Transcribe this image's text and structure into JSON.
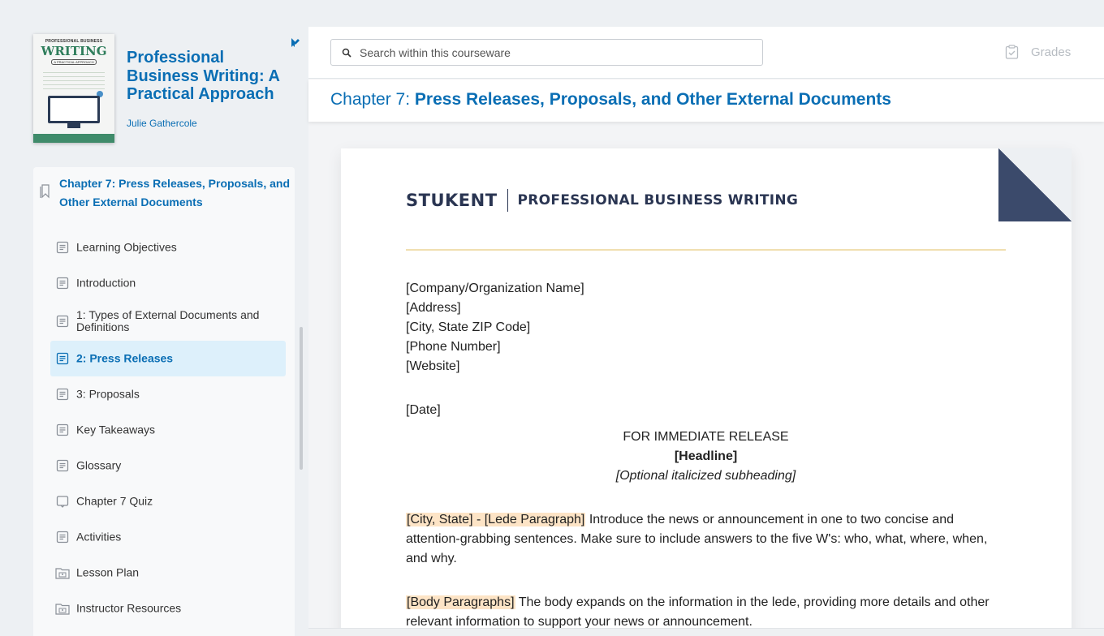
{
  "book": {
    "cover_small_text": "PROFESSIONAL BUSINESS",
    "cover_big_text": "WRITING",
    "cover_subtitle": "A PRACTICAL APPROACH",
    "title": "Professional Business Writing: A Practical Approach",
    "author": "Julie Gathercole"
  },
  "toc": {
    "chapter_label": "Chapter 7: Press Releases, Proposals, and Other External Documents",
    "items": [
      {
        "label": "Learning Objectives",
        "icon": "page-icon"
      },
      {
        "label": "Introduction",
        "icon": "page-icon"
      },
      {
        "label": "1: Types of External Documents and Definitions",
        "icon": "page-icon"
      },
      {
        "label": "2: Press Releases",
        "icon": "page-icon",
        "active": true
      },
      {
        "label": "3: Proposals",
        "icon": "page-icon"
      },
      {
        "label": "Key Takeaways",
        "icon": "page-icon"
      },
      {
        "label": "Glossary",
        "icon": "page-icon"
      },
      {
        "label": "Chapter 7 Quiz",
        "icon": "quiz-icon"
      },
      {
        "label": "Activities",
        "icon": "page-icon"
      },
      {
        "label": "Lesson Plan",
        "icon": "folder-icon"
      },
      {
        "label": "Instructor Resources",
        "icon": "folder-icon"
      }
    ]
  },
  "search": {
    "placeholder": "Search within this courseware"
  },
  "grades": {
    "label": "Grades"
  },
  "chapter_header": {
    "prefix": "Chapter 7: ",
    "title": "Press Releases, Proposals, and Other External Documents"
  },
  "document": {
    "brand_logo": "STUKENT",
    "brand_title": "PROFESSIONAL BUSINESS WRITING",
    "address_lines": [
      "[Company/Organization Name]",
      "[Address]",
      "[City, State ZIP Code]",
      "[Phone Number]",
      "[Website]"
    ],
    "date": "[Date]",
    "release": "FOR IMMEDIATE RELEASE",
    "headline": "[Headline]",
    "subheading": "[Optional italicized subheading]",
    "lede_highlight": "[City, State] - [Lede Paragraph]",
    "lede_text": " Introduce the news or announcement in one to two concise and attention-grabbing sentences. Make sure to include answers to the five W's: who, what, where, when, and why.",
    "body_highlight": "[Body Paragraphs]",
    "body_text": " The body expands on the information in the lede, providing more details and other relevant information to support your news or announcement."
  },
  "colors": {
    "accent": "#0a6eb4",
    "active_bg": "#ddf0fb",
    "highlight": "#fde4c6",
    "brand_navy": "#2a3552"
  }
}
